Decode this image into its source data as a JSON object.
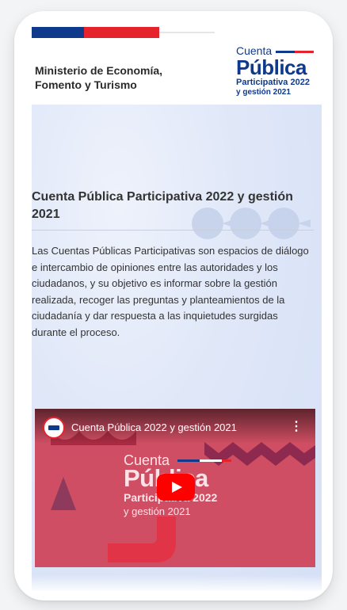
{
  "header": {
    "ministry": "Ministerio de Economía, Fomento y Turismo",
    "logo": {
      "cuenta": "Cuenta",
      "publica": "Pública",
      "participativa": "Participativa 2022",
      "gestion": "y gestión 2021"
    }
  },
  "main": {
    "title": "Cuenta Pública Participativa 2022 y gestión 2021",
    "body": "Las Cuentas Públicas Participativas son espacios de diálogo e intercambio de opiniones entre las autoridades y los ciudadanos, y su objetivo es informar sobre la gestión realizada, recoger las preguntas y planteamientos de la ciudadanía y dar respuesta a las inquietudes surgidas durante el proceso."
  },
  "video": {
    "title": "Cuenta Pública 2022 y gestión 2021",
    "menu_icon": "more-vert-icon",
    "play_icon": "youtube-play-icon",
    "thumbnail": {
      "cuenta": "Cuenta",
      "publica": "Pública",
      "participativa": "Participativa 2022",
      "gestion": "y gestión 2021"
    }
  },
  "colors": {
    "brand_blue": "#0f3a8c",
    "brand_red": "#e5232d",
    "video_bg": "#cf4e63"
  }
}
